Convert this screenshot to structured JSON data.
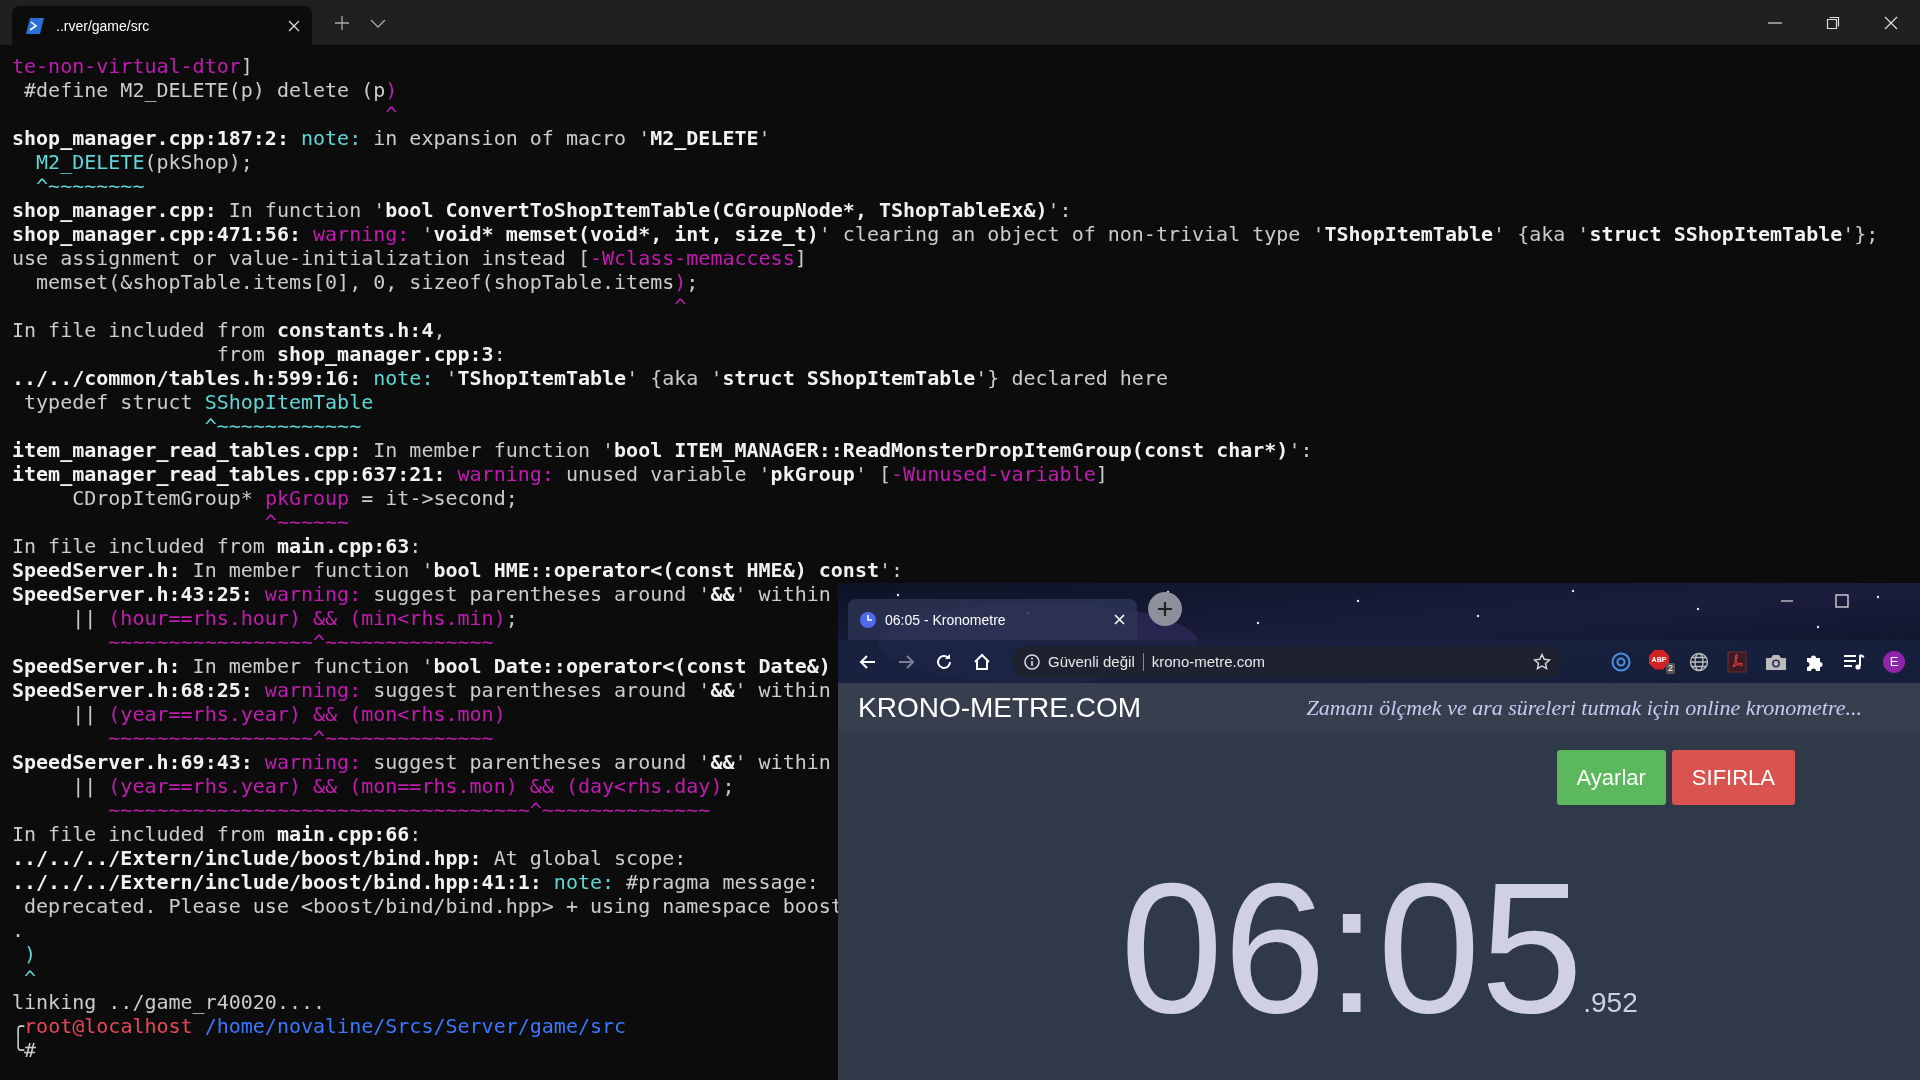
{
  "terminal": {
    "tab": {
      "title": "..rver/game/src"
    },
    "lines": [
      [
        {
          "kind": "magenta",
          "text": "te-non-virtual-dtor"
        },
        {
          "kind": "plain",
          "text": "]"
        }
      ],
      [
        {
          "kind": "plain",
          "text": " #define M2_DELETE(p) delete (p"
        },
        {
          "kind": "magenta",
          "text": ")"
        }
      ],
      [
        {
          "kind": "magenta",
          "text": "                               ^"
        }
      ],
      [
        {
          "kind": "bold",
          "text": "shop_manager.cpp:187:2:"
        },
        {
          "kind": "note",
          "text": " note:"
        },
        {
          "kind": "plain",
          "text": " in expansion of macro '"
        },
        {
          "kind": "bold",
          "text": "M2_DELETE"
        },
        {
          "kind": "plain",
          "text": "'"
        }
      ],
      [
        {
          "kind": "cyan",
          "text": "  M2_DELETE"
        },
        {
          "kind": "plain",
          "text": "(pkShop);"
        }
      ],
      [
        {
          "kind": "cyan",
          "text": "  ^~~~~~~~~"
        }
      ],
      [
        {
          "kind": "bold",
          "text": "shop_manager.cpp:"
        },
        {
          "kind": "plain",
          "text": " In function '"
        },
        {
          "kind": "bold",
          "text": "bool ConvertToShopItemTable(CGroupNode*, TShopTableEx&)"
        },
        {
          "kind": "plain",
          "text": "':"
        }
      ],
      [
        {
          "kind": "bold",
          "text": "shop_manager.cpp:471:56:"
        },
        {
          "kind": "warning",
          "text": " warning:"
        },
        {
          "kind": "plain",
          "text": " '"
        },
        {
          "kind": "bold",
          "text": "void* memset(void*, int, size_t)"
        },
        {
          "kind": "plain",
          "text": "' clearing an object of non-trivial type '"
        },
        {
          "kind": "bold",
          "text": "TShopItemTable"
        },
        {
          "kind": "plain",
          "text": "' {aka '"
        },
        {
          "kind": "bold",
          "text": "struct SShopItemTable"
        },
        {
          "kind": "plain",
          "text": "'};"
        }
      ],
      [
        {
          "kind": "plain",
          "text": "use assignment or value-initialization instead ["
        },
        {
          "kind": "magenta",
          "text": "-Wclass-memaccess"
        },
        {
          "kind": "plain",
          "text": "]"
        }
      ],
      [
        {
          "kind": "plain",
          "text": "  memset(&shopTable.items[0], 0, sizeof(shopTable.items"
        },
        {
          "kind": "magenta",
          "text": ")"
        },
        {
          "kind": "plain",
          "text": ";"
        }
      ],
      [
        {
          "kind": "magenta",
          "text": "                                                       ^"
        }
      ],
      [
        {
          "kind": "plain",
          "text": "In file included from "
        },
        {
          "kind": "bold",
          "text": "constants.h:4"
        },
        {
          "kind": "plain",
          "text": ","
        }
      ],
      [
        {
          "kind": "plain",
          "text": "                 from "
        },
        {
          "kind": "bold",
          "text": "shop_manager.cpp:3"
        },
        {
          "kind": "plain",
          "text": ":"
        }
      ],
      [
        {
          "kind": "bold",
          "text": "../../common/tables.h:599:16:"
        },
        {
          "kind": "note",
          "text": " note:"
        },
        {
          "kind": "plain",
          "text": " '"
        },
        {
          "kind": "bold",
          "text": "TShopItemTable"
        },
        {
          "kind": "plain",
          "text": "' {aka '"
        },
        {
          "kind": "bold",
          "text": "struct SShopItemTable"
        },
        {
          "kind": "plain",
          "text": "'} declared here"
        }
      ],
      [
        {
          "kind": "plain",
          "text": " typedef struct "
        },
        {
          "kind": "cyan",
          "text": "SShopItemTable"
        }
      ],
      [
        {
          "kind": "cyan",
          "text": "                ^~~~~~~~~~~~~"
        }
      ],
      [
        {
          "kind": "bold",
          "text": "item_manager_read_tables.cpp:"
        },
        {
          "kind": "plain",
          "text": " In member function '"
        },
        {
          "kind": "bold",
          "text": "bool ITEM_MANAGER::ReadMonsterDropItemGroup(const char*)"
        },
        {
          "kind": "plain",
          "text": "':"
        }
      ],
      [
        {
          "kind": "bold",
          "text": "item_manager_read_tables.cpp:637:21:"
        },
        {
          "kind": "warning",
          "text": " warning:"
        },
        {
          "kind": "plain",
          "text": " unused variable '"
        },
        {
          "kind": "bold",
          "text": "pkGroup"
        },
        {
          "kind": "plain",
          "text": "' ["
        },
        {
          "kind": "magenta",
          "text": "-Wunused-variable"
        },
        {
          "kind": "plain",
          "text": "]"
        }
      ],
      [
        {
          "kind": "plain",
          "text": "     CDropItemGroup* "
        },
        {
          "kind": "magenta",
          "text": "pkGroup"
        },
        {
          "kind": "plain",
          "text": " = it->second;"
        }
      ],
      [
        {
          "kind": "magenta",
          "text": "                     ^~~~~~~"
        }
      ],
      [
        {
          "kind": "plain",
          "text": "In file included from "
        },
        {
          "kind": "bold",
          "text": "main.cpp:63"
        },
        {
          "kind": "plain",
          "text": ":"
        }
      ],
      [
        {
          "kind": "bold",
          "text": "SpeedServer.h:"
        },
        {
          "kind": "plain",
          "text": " In member function '"
        },
        {
          "kind": "bold",
          "text": "bool HME::operator<(const HME&) const"
        },
        {
          "kind": "plain",
          "text": "':"
        }
      ],
      [
        {
          "kind": "bold",
          "text": "SpeedServer.h:43:25:"
        },
        {
          "kind": "warning",
          "text": " warning:"
        },
        {
          "kind": "plain",
          "text": " suggest parentheses around '"
        },
        {
          "kind": "bold",
          "text": "&&"
        },
        {
          "kind": "plain",
          "text": "' within"
        }
      ],
      [
        {
          "kind": "plain",
          "text": "     || "
        },
        {
          "kind": "magenta",
          "text": "(hour==rhs.hour) && (min<rhs.min)"
        },
        {
          "kind": "plain",
          "text": ";"
        }
      ],
      [
        {
          "kind": "magenta",
          "text": "        ~~~~~~~~~~~~~~~~~^~~~~~~~~~~~~~~"
        }
      ],
      [
        {
          "kind": "bold",
          "text": "SpeedServer.h:"
        },
        {
          "kind": "plain",
          "text": " In member function '"
        },
        {
          "kind": "bold",
          "text": "bool Date::operator<(const Date&)"
        }
      ],
      [
        {
          "kind": "bold",
          "text": "SpeedServer.h:68:25:"
        },
        {
          "kind": "warning",
          "text": " warning:"
        },
        {
          "kind": "plain",
          "text": " suggest parentheses around '"
        },
        {
          "kind": "bold",
          "text": "&&"
        },
        {
          "kind": "plain",
          "text": "' within"
        }
      ],
      [
        {
          "kind": "plain",
          "text": "     || "
        },
        {
          "kind": "magenta",
          "text": "(year==rhs.year) && (mon<rhs.mon)"
        }
      ],
      [
        {
          "kind": "magenta",
          "text": "        ~~~~~~~~~~~~~~~~~^~~~~~~~~~~~~~~"
        }
      ],
      [
        {
          "kind": "bold",
          "text": "SpeedServer.h:69:43:"
        },
        {
          "kind": "warning",
          "text": " warning:"
        },
        {
          "kind": "plain",
          "text": " suggest parentheses around '"
        },
        {
          "kind": "bold",
          "text": "&&"
        },
        {
          "kind": "plain",
          "text": "' within"
        }
      ],
      [
        {
          "kind": "plain",
          "text": "     || "
        },
        {
          "kind": "magenta",
          "text": "(year==rhs.year) && (mon==rhs.mon) && (day<rhs.day)"
        },
        {
          "kind": "plain",
          "text": ";"
        }
      ],
      [
        {
          "kind": "magenta",
          "text": "        ~~~~~~~~~~~~~~~~~~~~~~~~~~~~~~~~~~~^~~~~~~~~~~~~~~"
        }
      ],
      [
        {
          "kind": "plain",
          "text": "In file included from "
        },
        {
          "kind": "bold",
          "text": "main.cpp:66"
        },
        {
          "kind": "plain",
          "text": ":"
        }
      ],
      [
        {
          "kind": "bold",
          "text": "../../../Extern/include/boost/bind.hpp:"
        },
        {
          "kind": "plain",
          "text": " At global scope:"
        }
      ],
      [
        {
          "kind": "bold",
          "text": "../../../Extern/include/boost/bind.hpp:41:1:"
        },
        {
          "kind": "note",
          "text": " note:"
        },
        {
          "kind": "plain",
          "text": " #pragma message:"
        }
      ],
      [
        {
          "kind": "plain",
          "text": " deprecated. Please use <boost/bind/bind.hpp> + using namespace boost"
        }
      ],
      [
        {
          "kind": "plain",
          "text": "."
        }
      ],
      [
        {
          "kind": "cyan",
          "text": " )"
        }
      ],
      [
        {
          "kind": "cyan",
          "text": " ^"
        }
      ],
      [
        {
          "kind": "plain",
          "text": "linking ../game_r40020...."
        }
      ],
      [
        {
          "kind": "frame",
          "text": "╭"
        },
        {
          "kind": "user",
          "text": "root@localhost"
        },
        {
          "kind": "path",
          "text": " /home/novaline/Srcs/Server/game/src"
        }
      ],
      [
        {
          "kind": "frame",
          "text": "╰"
        },
        {
          "kind": "plain",
          "text": "#"
        }
      ]
    ]
  },
  "browser": {
    "tab": {
      "title": "06:05 - Kronometre"
    },
    "address": {
      "security": "Güvenli değil",
      "url": "krono-metre.com"
    },
    "extensions": [
      {
        "kind": "ring"
      },
      {
        "kind": "stop-sign",
        "label": "ABP",
        "badge": "2"
      },
      {
        "kind": "globe"
      },
      {
        "kind": "document"
      },
      {
        "kind": "camera"
      },
      {
        "kind": "puzzle"
      },
      {
        "kind": "playlist"
      }
    ],
    "profile": {
      "initial": "E"
    },
    "page": {
      "site_title": "KRONO-METRE.COM",
      "tagline": "Zamanı ölçmek ve ara süreleri tutmak için online kronometre...",
      "buttons": [
        {
          "kind": "settings",
          "label": "Ayarlar"
        },
        {
          "kind": "reset",
          "label": "SIFIRLA"
        }
      ],
      "timer": {
        "main": "06:05",
        "fraction": ".952"
      }
    }
  }
}
